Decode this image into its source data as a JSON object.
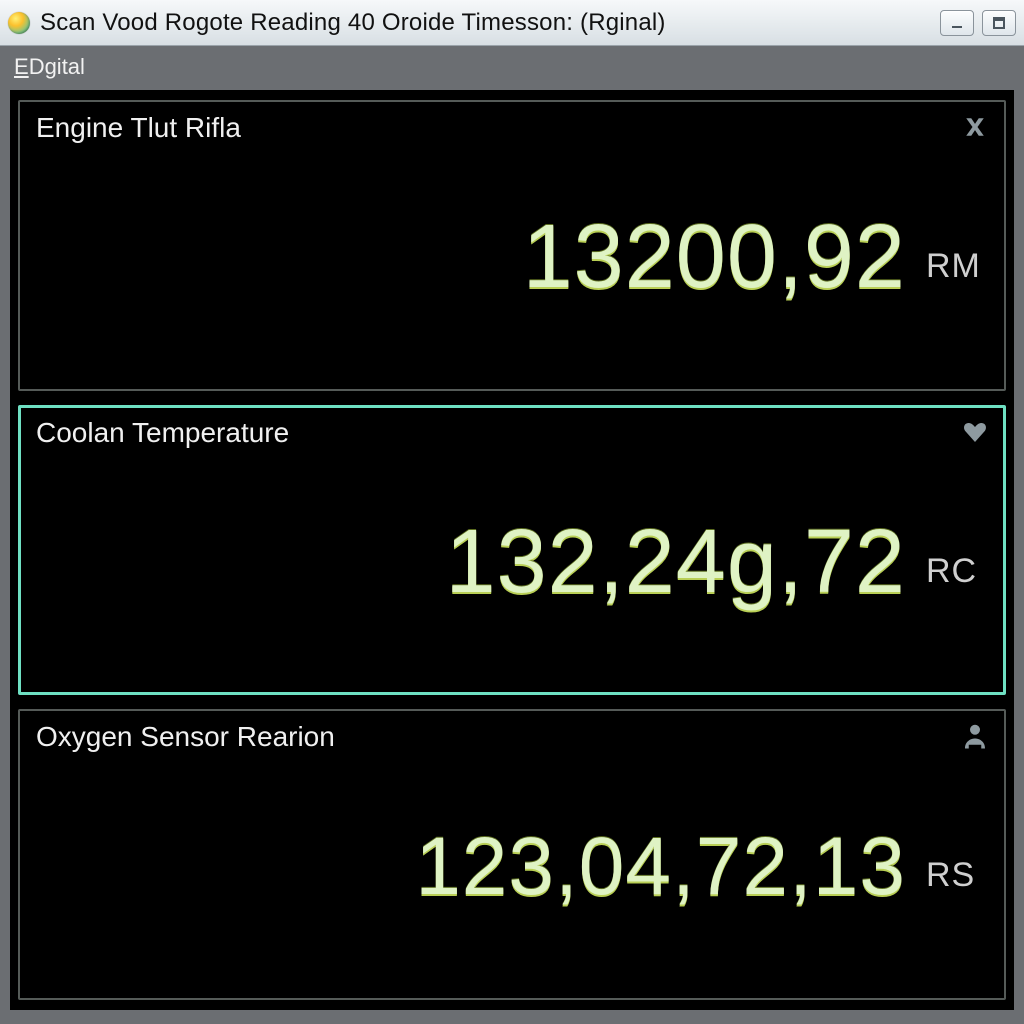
{
  "window": {
    "title": "Scan Vood Rogote Reading 40 Oroide Timesson: (Rginal)"
  },
  "menu": {
    "digital_label": "Dgital",
    "digital_hotkey": "E"
  },
  "gauges": [
    {
      "label": "Engine Tlut Rifla",
      "value": "13200,92",
      "unit": "RM",
      "icon": "close-x",
      "selected": false
    },
    {
      "label": "Coolan Temperature",
      "value": "132,24g,72",
      "unit": "RC",
      "icon": "heart-down",
      "selected": true
    },
    {
      "label": "Oxygen Sensor Rearion",
      "value": "123,04,72,13",
      "unit": "RS",
      "icon": "user",
      "selected": false
    }
  ]
}
